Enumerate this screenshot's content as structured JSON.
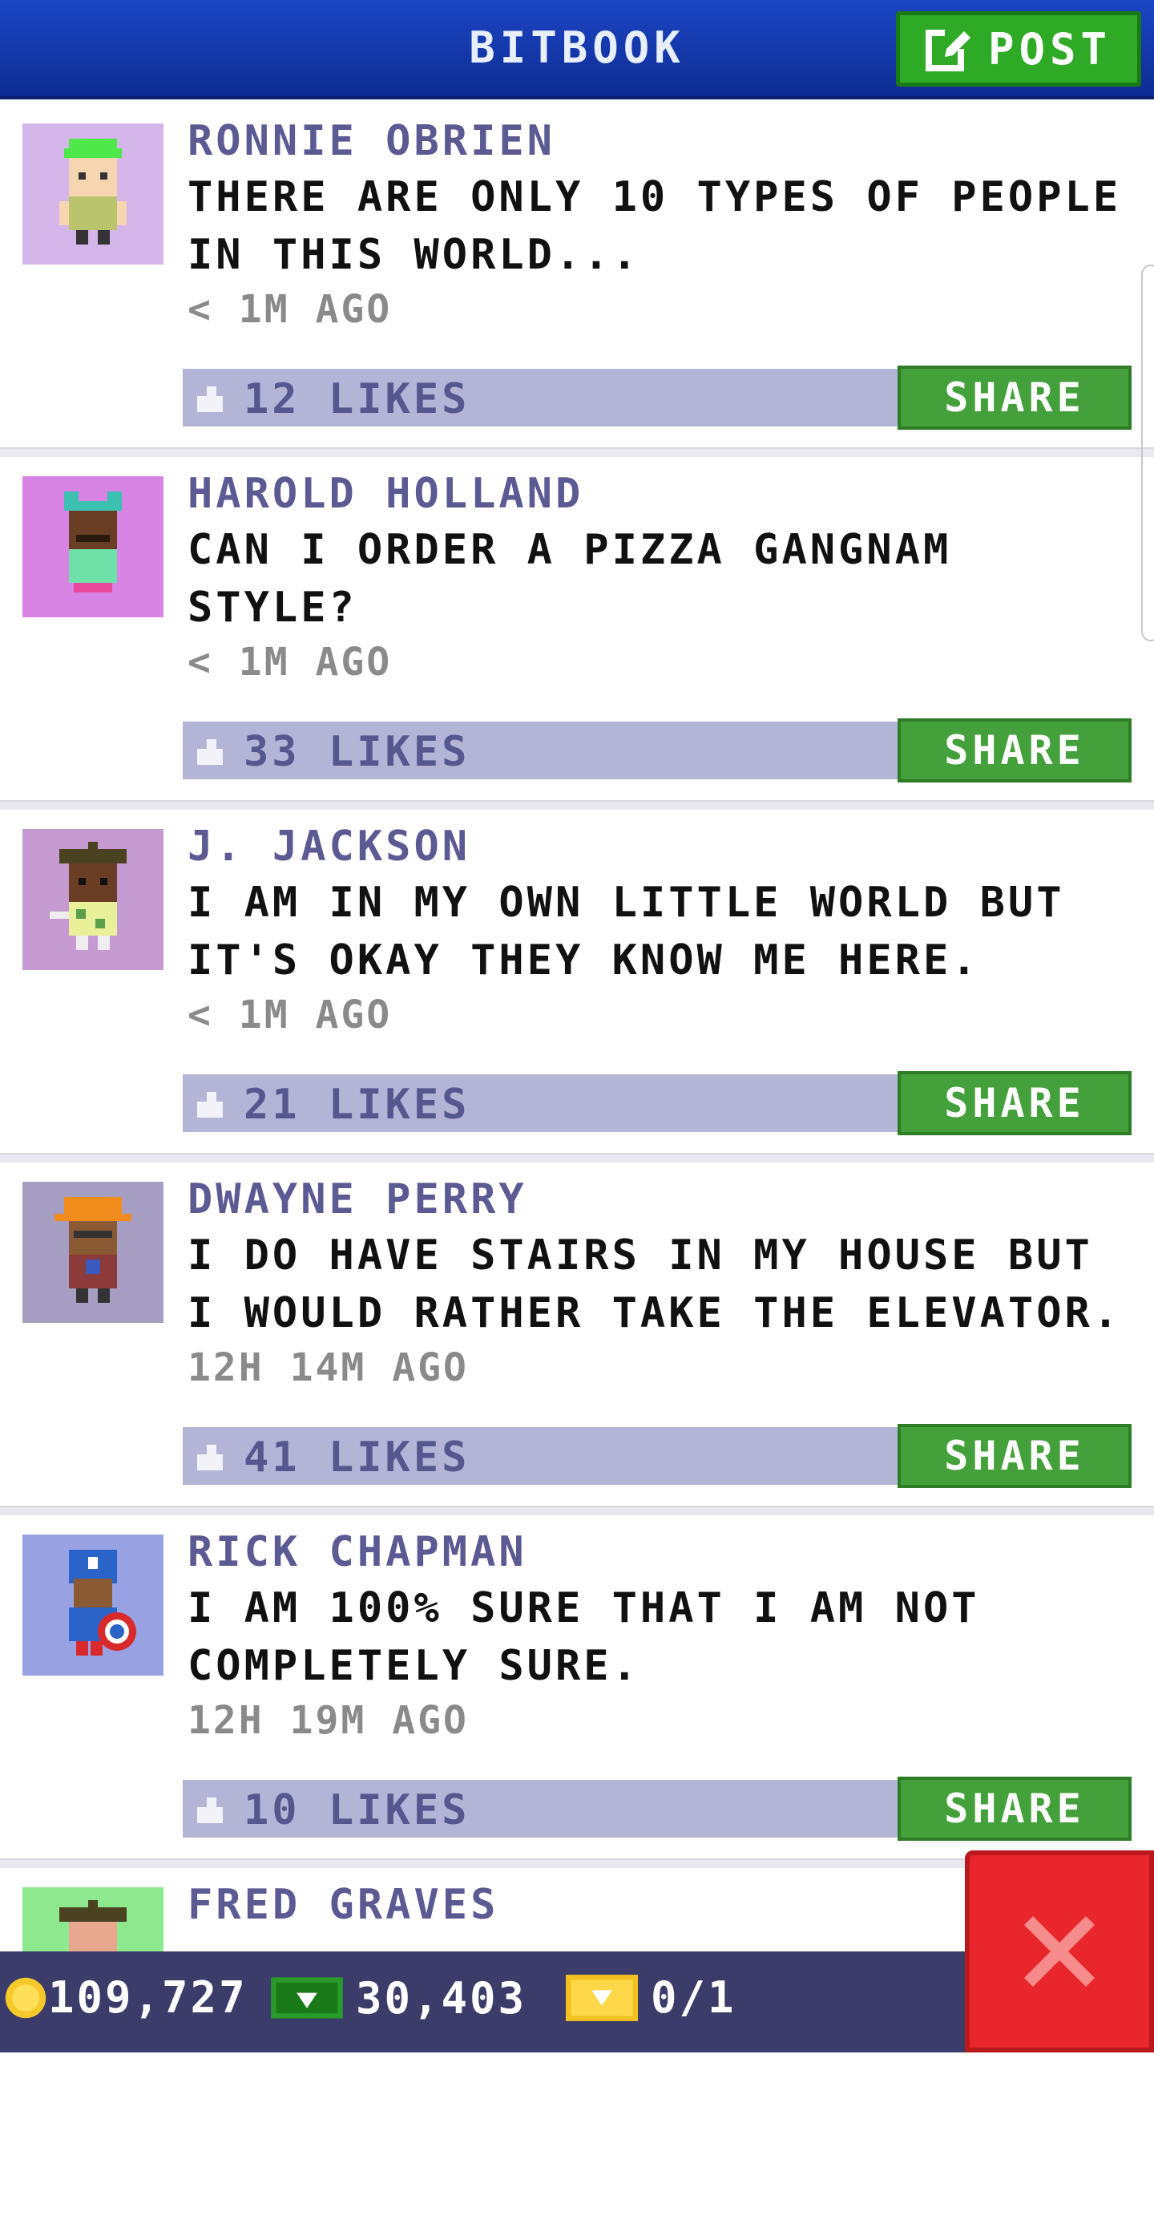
{
  "header": {
    "title": "BITBOOK",
    "post_label": "POST"
  },
  "posts": [
    {
      "author": "RONNIE OBRIEN",
      "message": "THERE ARE ONLY 10 TYPES OF PEOPLE IN THIS WORLD...",
      "time": "< 1M AGO",
      "likes": "12 LIKES",
      "share": "SHARE",
      "avatar_bg": "#d4b6ea",
      "avatar_icon": "green-hair-character"
    },
    {
      "author": "HAROLD HOLLAND",
      "message": "CAN I ORDER A PIZZA GANGNAM STYLE?",
      "time": "< 1M AGO",
      "likes": "33 LIKES",
      "share": "SHARE",
      "avatar_bg": "#d783e4",
      "avatar_icon": "cat-ears-character"
    },
    {
      "author": "J. JACKSON",
      "message": "I AM IN MY OWN LITTLE WORLD BUT IT'S OKAY THEY KNOW ME HERE.",
      "time": "< 1M AGO",
      "likes": "21 LIKES",
      "share": "SHARE",
      "avatar_bg": "#c49ad0",
      "avatar_icon": "beret-character"
    },
    {
      "author": "DWAYNE PERRY",
      "message": "I DO HAVE STAIRS IN MY HOUSE BUT I WOULD RATHER TAKE THE ELEVATOR.",
      "time": "12H 14M AGO",
      "likes": "41 LIKES",
      "share": "SHARE",
      "avatar_bg": "#a59ec2",
      "avatar_icon": "hardhat-character"
    },
    {
      "author": "RICK CHAPMAN",
      "message": "I AM 100% SURE THAT I AM NOT COMPLETELY SURE.",
      "time": "12H 19M AGO",
      "likes": "10 LIKES",
      "share": "SHARE",
      "avatar_bg": "#98a2e2",
      "avatar_icon": "shield-hero-character"
    },
    {
      "author": "FRED GRAVES",
      "message": "",
      "time": "",
      "likes": "",
      "share": "",
      "avatar_bg": "#8ee88e",
      "avatar_icon": "beret-character"
    }
  ],
  "footer": {
    "coins": "109,727",
    "bux": "30,403",
    "tickets": "0/1"
  },
  "colors": {
    "header": "#1b45c4",
    "post_button": "#2faa26",
    "share_button": "#44a03a",
    "like_bar": "#b4b5d6",
    "close": "#e8262b",
    "footer": "#3b3c69"
  }
}
